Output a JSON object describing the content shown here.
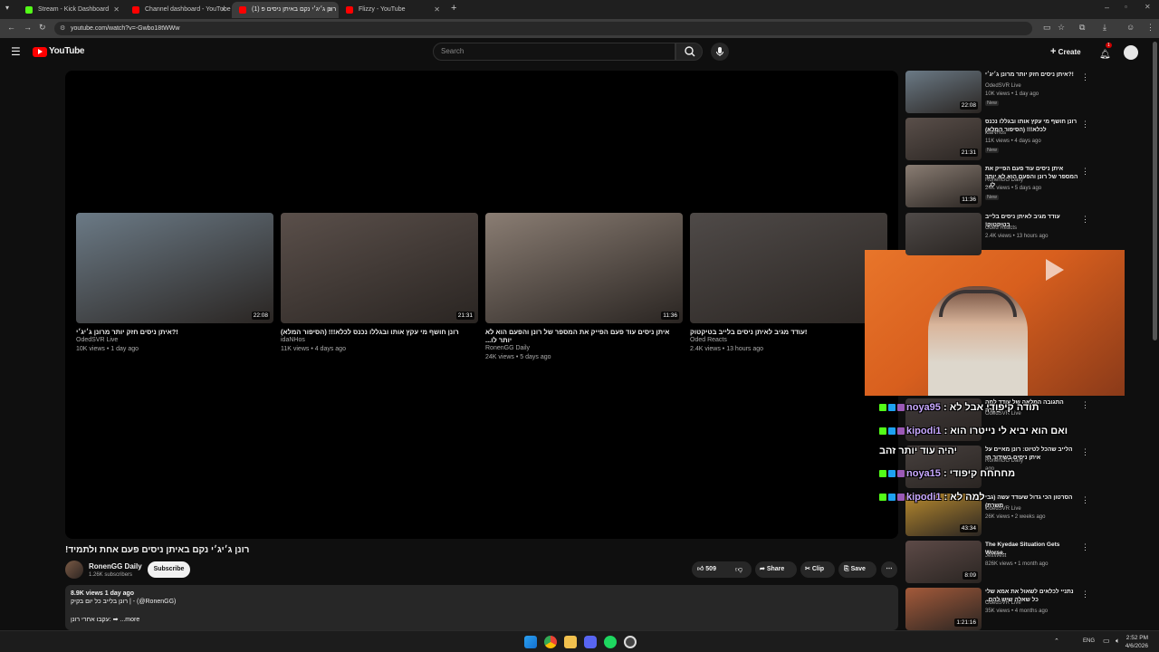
{
  "browser": {
    "tabs": [
      {
        "label": "Stream - Kick Dashboard",
        "favicon_color": "#53fc18"
      },
      {
        "label": "Channel dashboard - YouTube",
        "favicon_color": "#ff0000"
      },
      {
        "label": "(1) רונן ג׳יג׳י נקם באיתן ניסים פ",
        "favicon_color": "#ff0000"
      },
      {
        "label": "Flizzy - YouTube",
        "favicon_color": "#ff0000"
      }
    ],
    "url": "youtube.com/watch?v=-Gwbo18tWWw"
  },
  "youtube": {
    "logo_text": "YouTube",
    "search_placeholder": "Search",
    "create_label": "Create",
    "notif_count": "1"
  },
  "end_cards": [
    {
      "title": "!?איתן ניסים חזק יותר מרונן ג׳יג׳י",
      "channel": "OdedSVR Live",
      "meta": "10K views • 1 day ago",
      "duration": "22:08",
      "bg": "#6b7a86"
    },
    {
      "title": "רונן חושף מי עקץ אותו ובגללו נכנס לכלא!!! (הסיפור המלא)",
      "channel": "idaNHos",
      "meta": "11K views • 4 days ago",
      "duration": "21:31",
      "bg": "#5a4f4a"
    },
    {
      "title": "איתן ניסים עוד פעם הפייק את המספר של רונן והפעם הוא לא יותר לו...",
      "channel": "RonenGG Daily",
      "meta": "24K views • 5 days ago",
      "duration": "11:36",
      "bg": "#8a7d73"
    },
    {
      "title": "!עודד מגיב לאיתן ניסים בלייב בטיקטוק",
      "channel": "Oded Reacts",
      "meta": "2.4K views • 13 hours ago",
      "duration": "",
      "bg": "#4f4a48"
    }
  ],
  "video": {
    "title": "!רונן ג׳יג׳י נקם באיתן ניסים פעם אחת ולתמיד",
    "channel": "RonenGG Daily",
    "subscribers": "1.26K subscribers",
    "subscribe_label": "Subscribe",
    "likes": "509",
    "share_label": "Share",
    "clip_label": "Clip",
    "save_label": "Save",
    "desc_stats": "8.9K views  1 day ago",
    "desc_line1": "רונן בלייב כל יום בקיק | - (@RonenGG)",
    "desc_line2": "עקבו אחרי רונן: ➡ ...more"
  },
  "sidebar": [
    {
      "title": "!?איתן ניסים חזק יותר מרונן ג׳יג׳י",
      "channel": "OdedSVR Live",
      "views": "10K views • 1 day ago",
      "new": "New",
      "duration": "22:08",
      "bg": "#6b7a86"
    },
    {
      "title": "רונן חושף מי עקץ אותו ובגללו נכנס לכלא!!! (הסיפור המלא)",
      "channel": "idaNHos",
      "views": "11K views • 4 days ago",
      "new": "New",
      "duration": "21:31",
      "bg": "#5a4f4a"
    },
    {
      "title": "איתן ניסים עוד פעם הפייק את המספר של רונן והפעם הוא לא יותר לו...",
      "channel": "RonenGG Daily",
      "views": "24K views • 5 days ago",
      "new": "New",
      "duration": "11:36",
      "bg": "#8a7d73"
    },
    {
      "title": "עודד מגיב לאיתן ניסים בלייב בטיקטוק!",
      "channel": "Oded Reacts",
      "views": "2.4K views • 13 hours ago",
      "new": "",
      "duration": "",
      "bg": "#4f4a48"
    },
    {
      "title": "התגובה המלאה של עודד למה שקרה",
      "channel": "OdedSVR Live",
      "views": "",
      "new": "",
      "duration": "",
      "bg": "#3e3838"
    },
    {
      "title": "הלייב שהכל לטיוט: רונן מאיים על איתן ניסים בשידור חי",
      "channel": "RonenGG Daily",
      "views": "ago",
      "new": "",
      "duration": "",
      "bg": "#47403e"
    },
    {
      "title": "הסרטון הכי גדול שעודד עשה (גבי משרת)",
      "channel": "OdedSVR Live",
      "views": "26K views • 2 weeks ago",
      "new": "",
      "duration": "43:34",
      "bg": "#b88a2e"
    },
    {
      "title": "The Kyedae Situation Gets Worse..",
      "channel": "JettWest",
      "views": "826K views • 1 month ago",
      "new": "",
      "duration": "8:09",
      "bg": "#5d4a47"
    },
    {
      "title": "נתניי לכלאים לשאול את אמא שלי כל שאלה שיש להם..",
      "channel": "OdedSVR Live",
      "views": "35K views • 4 months ago",
      "new": "",
      "duration": "1:21:16",
      "bg": "#a45a3a"
    }
  ],
  "chat": [
    {
      "user": "noya95",
      "message": "תודה קיפודי אבל לא"
    },
    {
      "user": "kipodi1",
      "message": "ואם הוא יביא לי נייטרו הוא"
    },
    {
      "user": "",
      "message": "יהיה עוד יותר זהב"
    },
    {
      "user": "noya15",
      "message": "מחחחח קיפודי"
    },
    {
      "user": "kipodi1",
      "message": "למה לא"
    }
  ],
  "taskbar": {
    "time": "2:52 PM",
    "date": "4/6/2026",
    "lang": "ENG"
  }
}
